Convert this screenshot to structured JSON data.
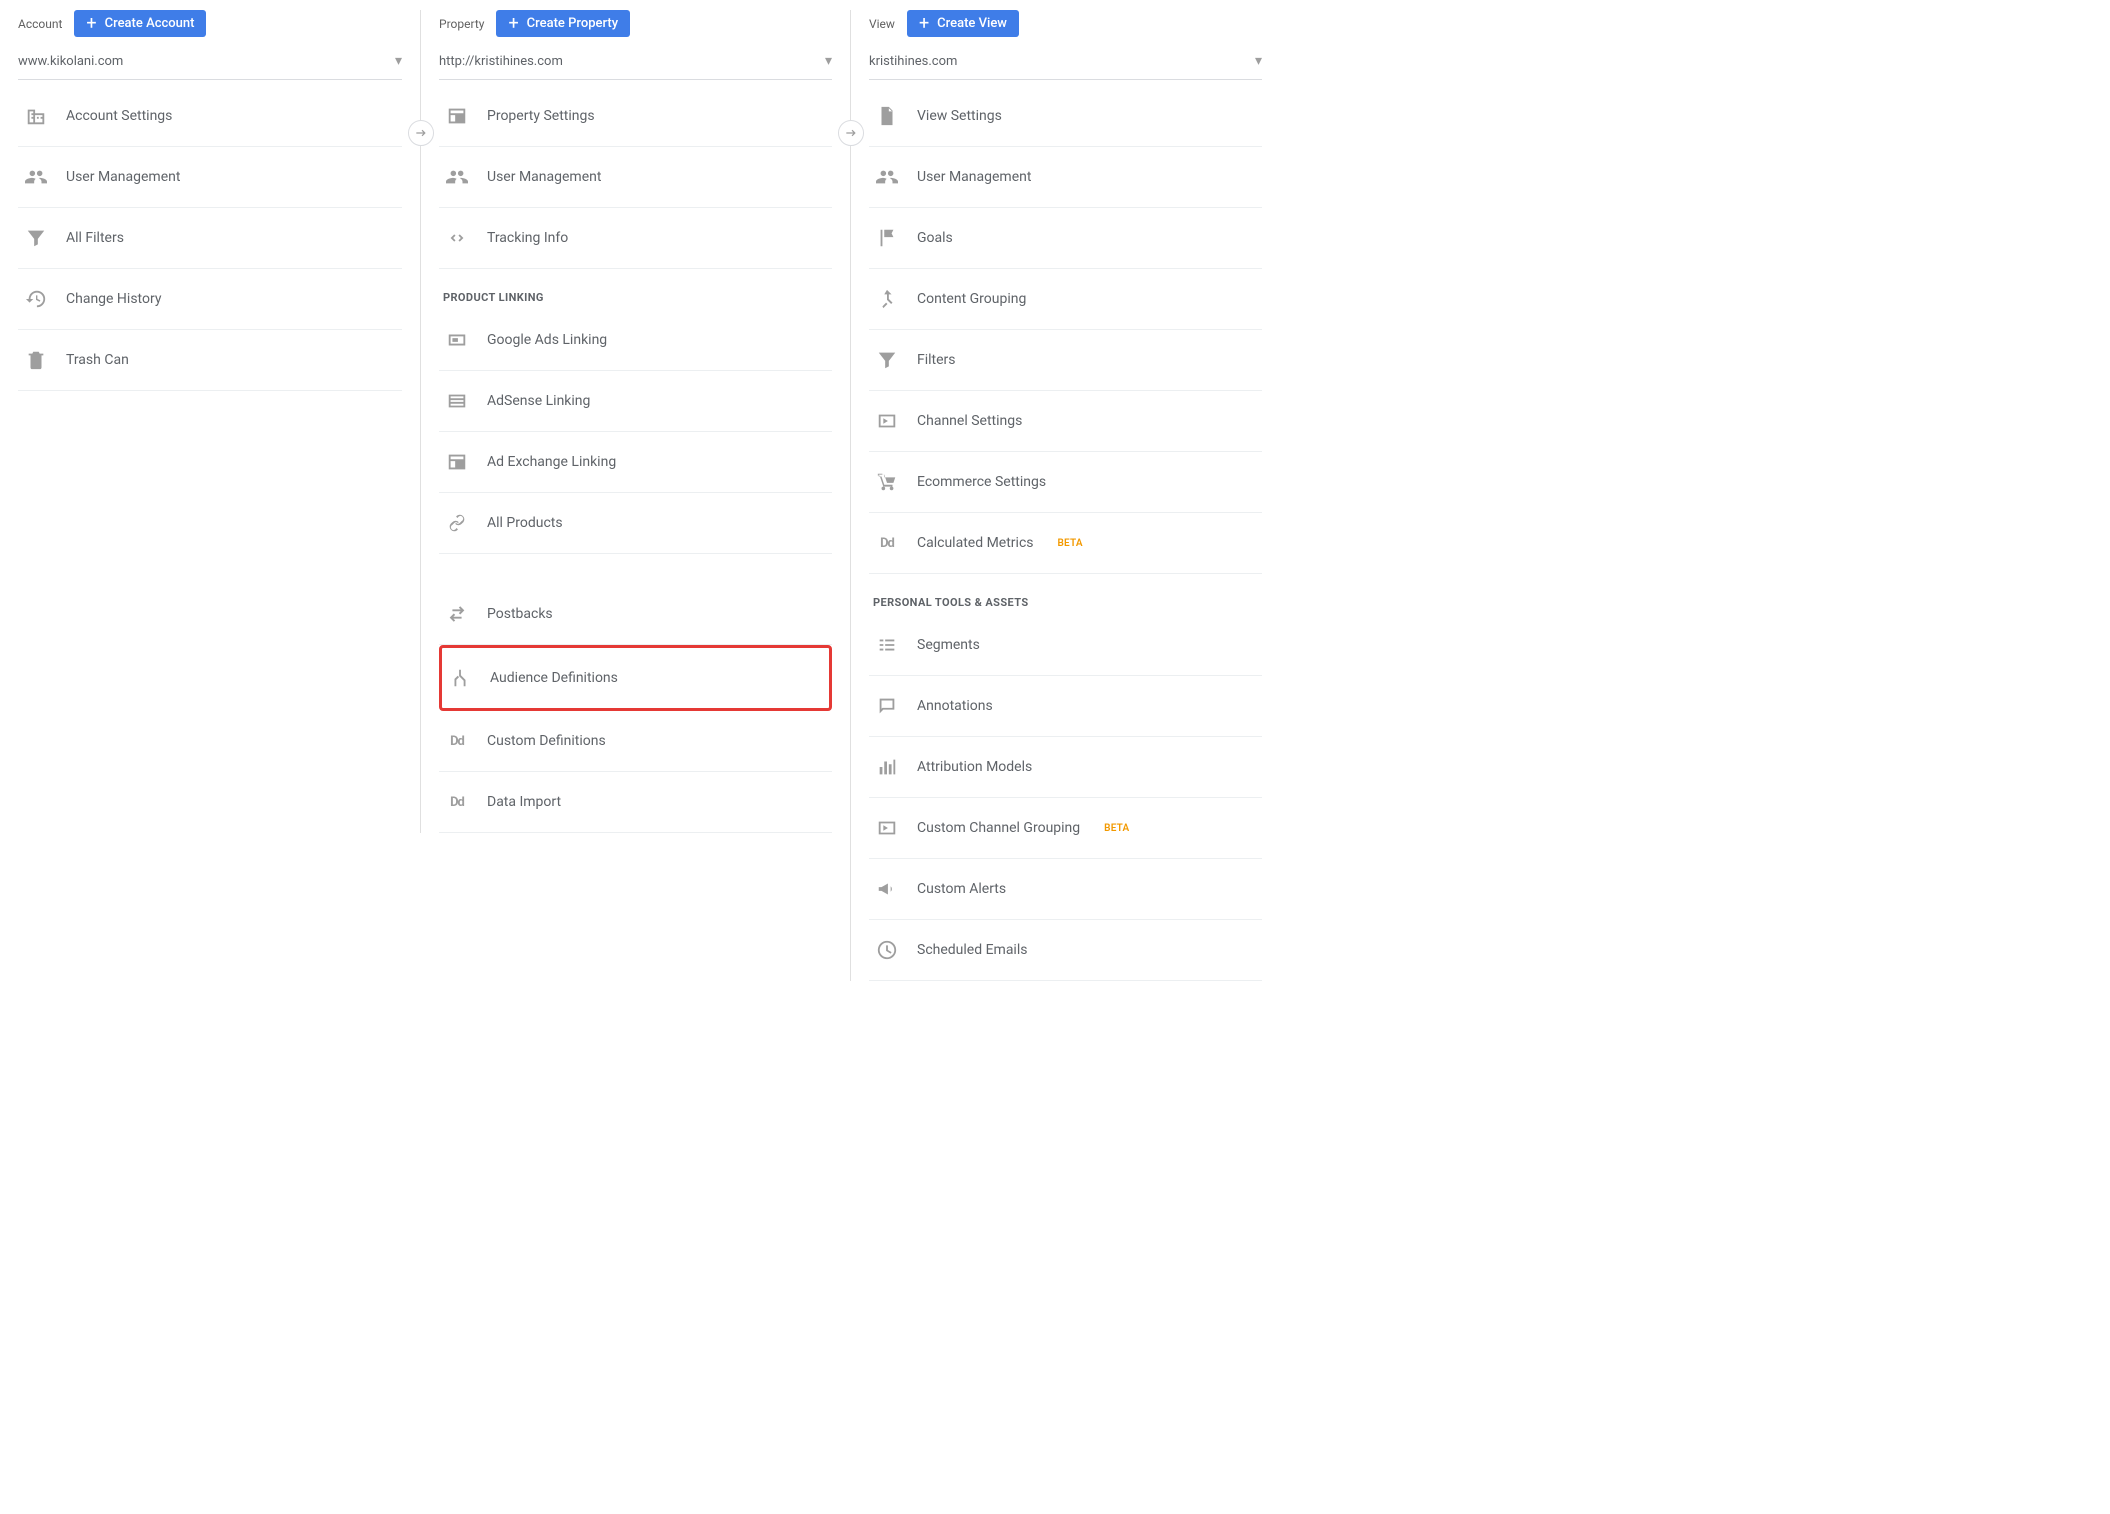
{
  "account": {
    "heading": "Account",
    "create_label": "Create Account",
    "selected": "www.kikolani.com",
    "items": [
      {
        "label": "Account Settings",
        "icon": "building"
      },
      {
        "label": "User Management",
        "icon": "users"
      },
      {
        "label": "All Filters",
        "icon": "funnel"
      },
      {
        "label": "Change History",
        "icon": "history"
      },
      {
        "label": "Trash Can",
        "icon": "trash"
      }
    ]
  },
  "property": {
    "heading": "Property",
    "create_label": "Create Property",
    "selected": "http://kristihines.com",
    "items": [
      {
        "label": "Property Settings",
        "icon": "layout"
      },
      {
        "label": "User Management",
        "icon": "users"
      },
      {
        "label": "Tracking Info",
        "icon": "code"
      }
    ],
    "section1": "PRODUCT LINKING",
    "linking": [
      {
        "label": "Google Ads Linking",
        "icon": "ads"
      },
      {
        "label": "AdSense Linking",
        "icon": "list"
      },
      {
        "label": "Ad Exchange Linking",
        "icon": "layout"
      },
      {
        "label": "All Products",
        "icon": "link"
      }
    ],
    "more": [
      {
        "label": "Postbacks",
        "icon": "swap"
      },
      {
        "label": "Audience Definitions",
        "icon": "split",
        "highlight": true
      },
      {
        "label": "Custom Definitions",
        "icon": "dd"
      },
      {
        "label": "Data Import",
        "icon": "dd"
      }
    ]
  },
  "view": {
    "heading": "View",
    "create_label": "Create View",
    "selected": "kristihines.com",
    "items": [
      {
        "label": "View Settings",
        "icon": "file"
      },
      {
        "label": "User Management",
        "icon": "users"
      },
      {
        "label": "Goals",
        "icon": "flag"
      },
      {
        "label": "Content Grouping",
        "icon": "merge"
      },
      {
        "label": "Filters",
        "icon": "funnel"
      },
      {
        "label": "Channel Settings",
        "icon": "channels"
      },
      {
        "label": "Ecommerce Settings",
        "icon": "cart"
      },
      {
        "label": "Calculated Metrics",
        "icon": "dd",
        "beta": "BETA"
      }
    ],
    "section1": "PERSONAL TOOLS & ASSETS",
    "personal": [
      {
        "label": "Segments",
        "icon": "segments"
      },
      {
        "label": "Annotations",
        "icon": "comment"
      },
      {
        "label": "Attribution Models",
        "icon": "bars"
      },
      {
        "label": "Custom Channel Grouping",
        "icon": "channels",
        "beta": "BETA"
      },
      {
        "label": "Custom Alerts",
        "icon": "megaphone"
      },
      {
        "label": "Scheduled Emails",
        "icon": "clock"
      }
    ]
  }
}
